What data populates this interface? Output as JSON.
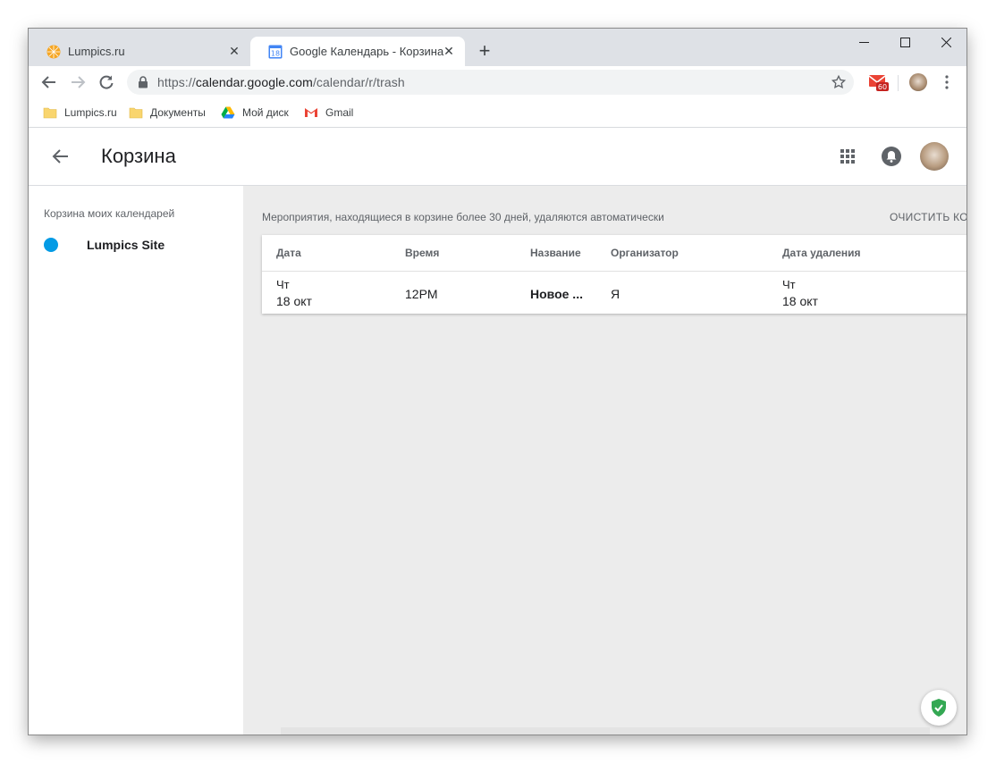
{
  "browser": {
    "tabs": [
      {
        "title": "Lumpics.ru",
        "close": "✕"
      },
      {
        "title": "Google Календарь - Корзина",
        "favicon_text": "18",
        "close": "✕"
      }
    ],
    "new_tab": "+",
    "window_controls": {
      "minimize": "—",
      "maximize": "☐",
      "close": "✕"
    },
    "address": {
      "scheme": "https://",
      "host": "calendar.google.com",
      "path": "/calendar/r/trash"
    },
    "gmail_badge": "60",
    "bookmarks": [
      {
        "label": "Lumpics.ru"
      },
      {
        "label": "Документы"
      },
      {
        "label": "Мой диск"
      },
      {
        "label": "Gmail"
      }
    ]
  },
  "header": {
    "title": "Корзина"
  },
  "sidebar": {
    "heading": "Корзина моих календарей",
    "calendars": [
      {
        "name": "Lumpics Site",
        "color": "#039be5"
      }
    ]
  },
  "main": {
    "notice": "Мероприятия, находящиеся в корзине более 30 дней, удаляются автоматически",
    "clear_button": "ОЧИСТИТЬ КОР",
    "table": {
      "headers": [
        "Дата",
        "Время",
        "Название",
        "Организатор",
        "Дата удаления"
      ],
      "rows": [
        {
          "date_day": "Чт",
          "date": "18 окт",
          "time": "12PM",
          "name": "Новое ...",
          "organizer": "Я",
          "deleted_day": "Чт",
          "deleted_date": "18 окт"
        }
      ]
    }
  },
  "colors": {
    "accent": "#039be5",
    "shield": "#34a853",
    "gmail": "#ea4335"
  }
}
